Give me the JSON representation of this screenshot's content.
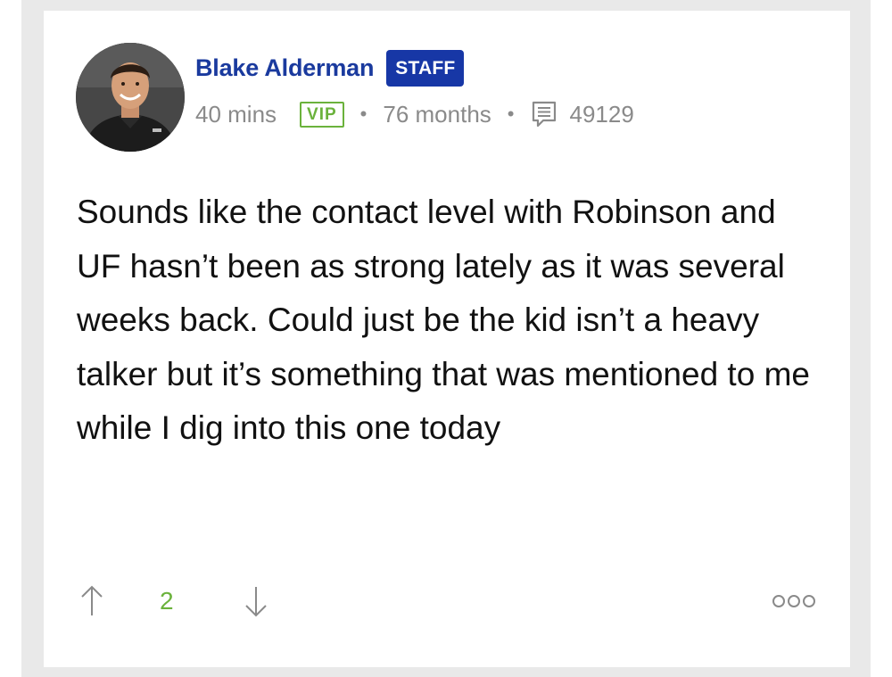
{
  "author": {
    "name": "Blake Alderman",
    "badge": "STAFF"
  },
  "meta": {
    "time_ago": "40 mins",
    "vip_label": "VIP",
    "separator": "•",
    "tenure": "76 months",
    "post_count": "49129"
  },
  "post": {
    "body": "Sounds like the contact level with Robinson and UF hasn’t been as strong lately as it was several weeks back. Could just be the kid isn’t a heavy talker but it’s something that was mentioned to me while I dig into this one today"
  },
  "votes": {
    "count": "2"
  },
  "icons": {
    "avatar": "user-photo",
    "posts": "message-icon",
    "upvote": "arrow-up-icon",
    "downvote": "arrow-down-icon",
    "more": "more-options-icon"
  },
  "colors": {
    "author_name": "#1a3a9e",
    "staff_badge": "#1737a6",
    "vip": "#6bb23c",
    "meta_text": "#8a8a8a",
    "vote_count": "#6bb23c"
  }
}
